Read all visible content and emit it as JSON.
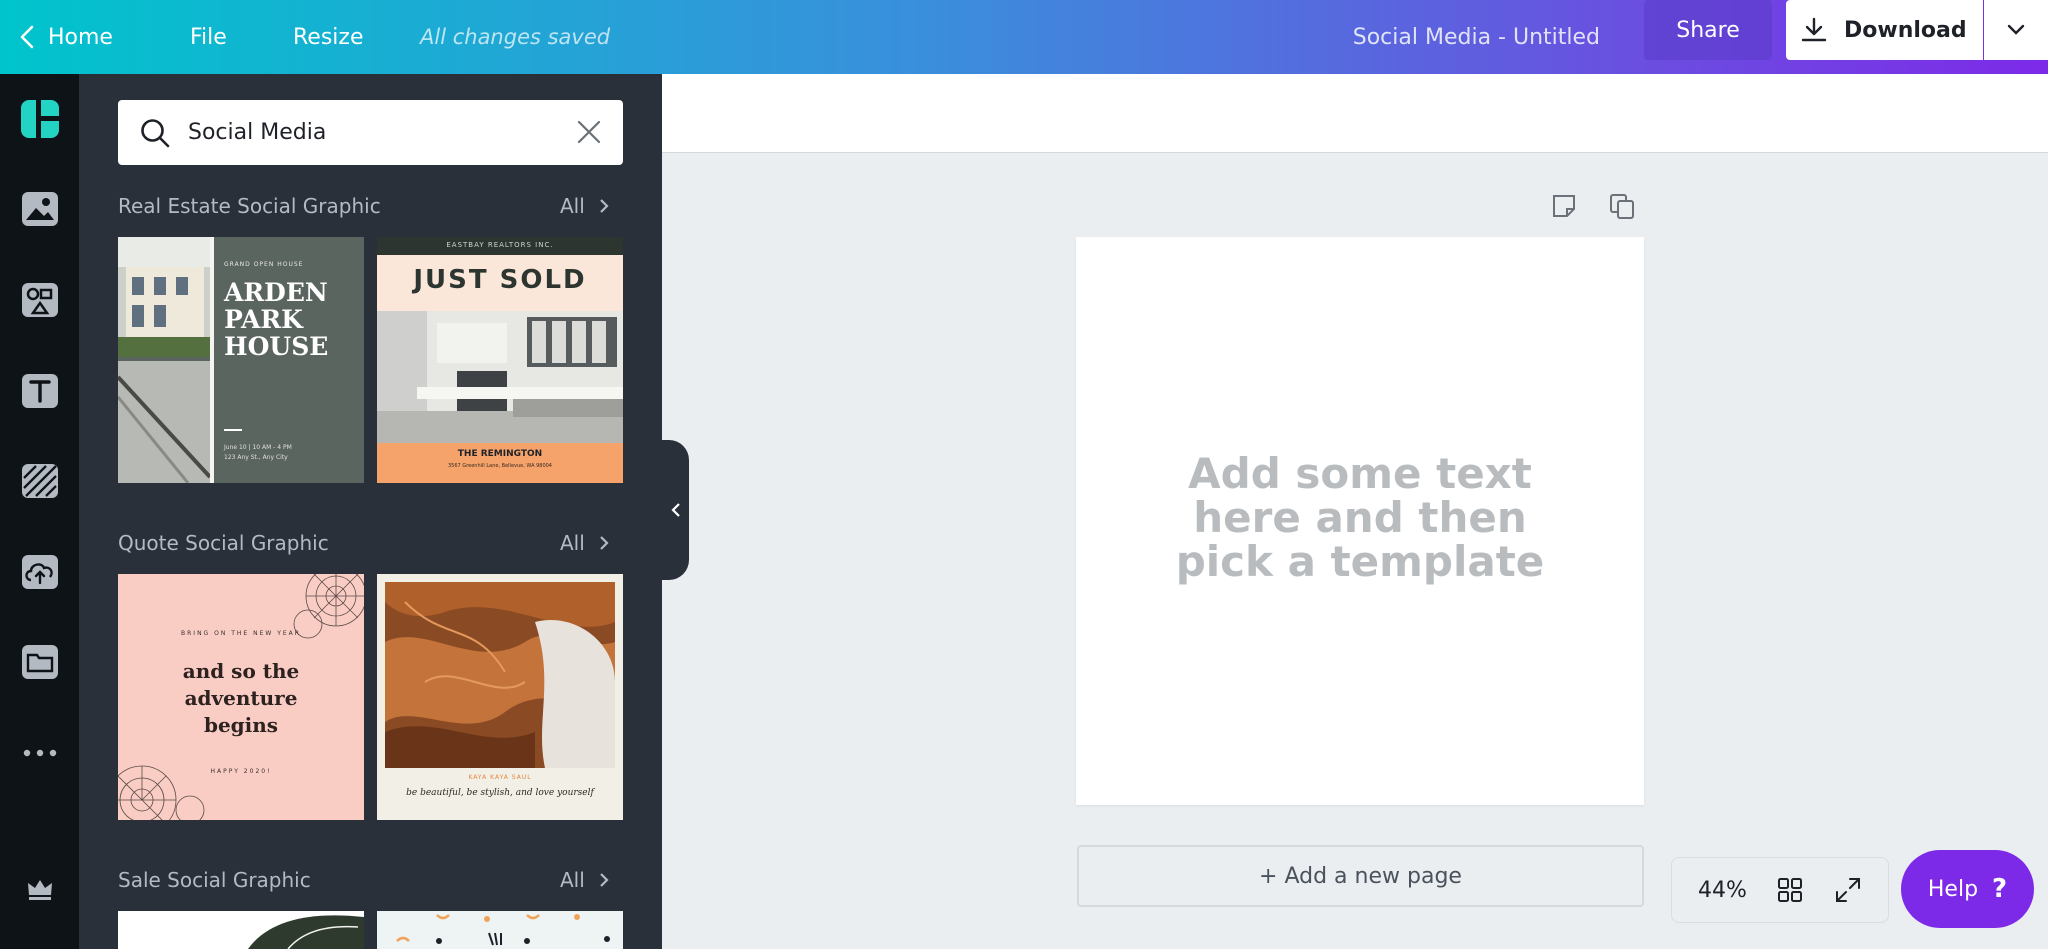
{
  "header": {
    "home_label": "Home",
    "file_label": "File",
    "resize_label": "Resize",
    "saved_status": "All changes saved",
    "doc_title": "Social Media - Untitled",
    "share_label": "Share",
    "download_label": "Download"
  },
  "rail": {
    "items": [
      "logo-icon",
      "photos-icon",
      "elements-icon",
      "text-icon",
      "background-icon",
      "uploads-icon",
      "folders-icon",
      "more-icon",
      "crown-icon"
    ]
  },
  "panel": {
    "search": {
      "value": "Social Media"
    },
    "sections": [
      {
        "title": "Real Estate Social Graphic",
        "all_label": "All"
      },
      {
        "title": "Quote Social Graphic",
        "all_label": "All"
      },
      {
        "title": "Sale Social Graphic",
        "all_label": "All"
      }
    ],
    "thumbs": {
      "arden": {
        "kicker": "GRAND OPEN HOUSE",
        "line1": "ARDEN",
        "line2": "PARK",
        "line3": "HOUSE",
        "foot1": "June 10 | 10 AM - 4 PM",
        "foot2": "123 Any St., Any City"
      },
      "sold": {
        "company": "EASTBAY REALTORS INC.",
        "headline": "JUST SOLD",
        "name": "THE REMINGTON",
        "address": "3567 Greenhill Lane, Bellevue, WA 98004"
      },
      "quote": {
        "kicker": "BRING ON THE NEW YEAR",
        "line1": "and so the",
        "line2": "adventure",
        "line3": "begins",
        "foot": "HAPPY 2020!"
      },
      "hair": {
        "author": "KAYA KAYA SAUL",
        "quote": "be beautiful, be stylish, and love yourself"
      }
    }
  },
  "canvas": {
    "page_hint_lines": [
      "Add some text",
      "here and then",
      "pick a template"
    ],
    "add_page_label": "+ Add a new page",
    "zoom": "44%",
    "help_label": "Help",
    "help_mark": "?"
  },
  "colors": {
    "brand_purple": "#7d2ae8",
    "brand_teal": "#00c4cc",
    "panel_bg": "#293039",
    "rail_bg": "#0e1318"
  }
}
